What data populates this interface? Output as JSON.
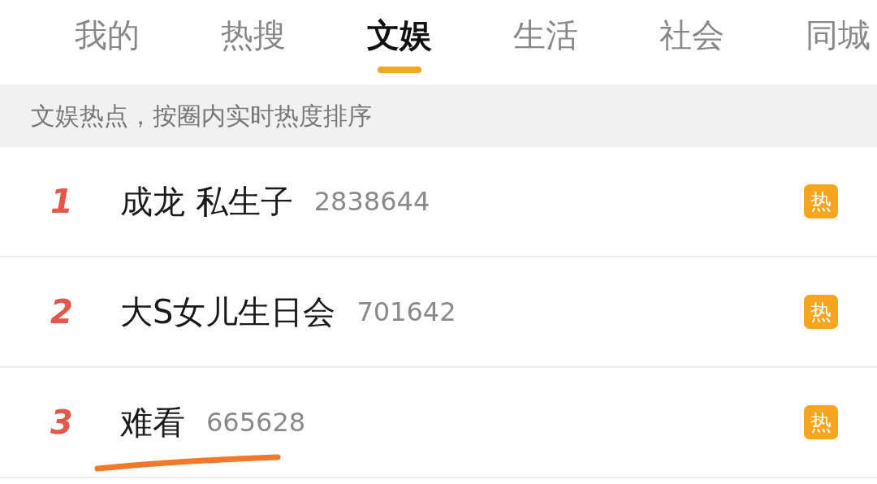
{
  "tabs": [
    {
      "label": "我的",
      "selected": false
    },
    {
      "label": "热搜",
      "selected": false
    },
    {
      "label": "文娱",
      "selected": true
    },
    {
      "label": "生活",
      "selected": false
    },
    {
      "label": "社会",
      "selected": false
    },
    {
      "label": "同城",
      "selected": false
    }
  ],
  "notice": "文娱热点，按圈内实时热度排序",
  "rows": [
    {
      "rank": "1",
      "title": "成龙 私生子",
      "count": "2838644",
      "badge": "热",
      "underlined": false
    },
    {
      "rank": "2",
      "title": "大S女儿生日会",
      "count": "701642",
      "badge": "热",
      "underlined": false
    },
    {
      "rank": "3",
      "title": "难看",
      "count": "665628",
      "badge": "热",
      "underlined": true
    }
  ]
}
